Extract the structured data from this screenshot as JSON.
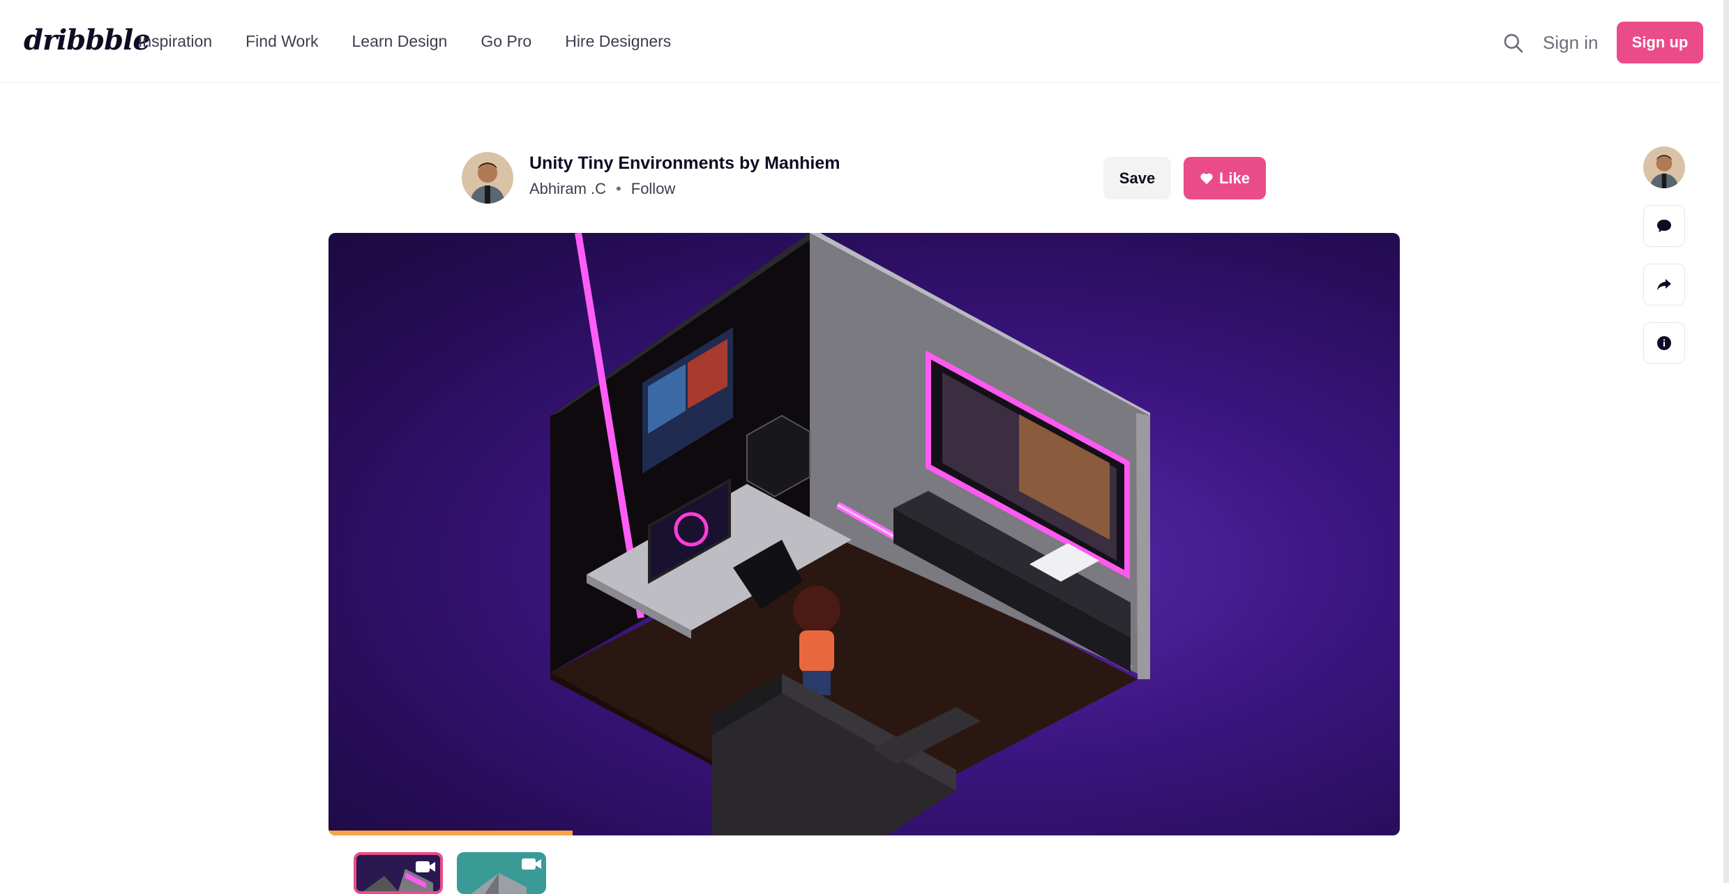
{
  "header": {
    "logo": "dribbble",
    "nav": [
      "Inspiration",
      "Find Work",
      "Learn Design",
      "Go Pro",
      "Hire Designers"
    ],
    "sign_in": "Sign in",
    "sign_up": "Sign up"
  },
  "shot": {
    "title": "Unity Tiny Environments by Manhiem",
    "author": "Abhiram .C",
    "separator": "•",
    "follow": "Follow",
    "save": "Save",
    "like": "Like"
  },
  "colors": {
    "brand_pink": "#ea4c89",
    "progress": "#f7a34b"
  },
  "media": {
    "progress_fraction": 0.228
  },
  "icons": [
    "search-icon",
    "heart-icon",
    "comment-icon",
    "share-icon",
    "info-icon",
    "video-icon"
  ]
}
